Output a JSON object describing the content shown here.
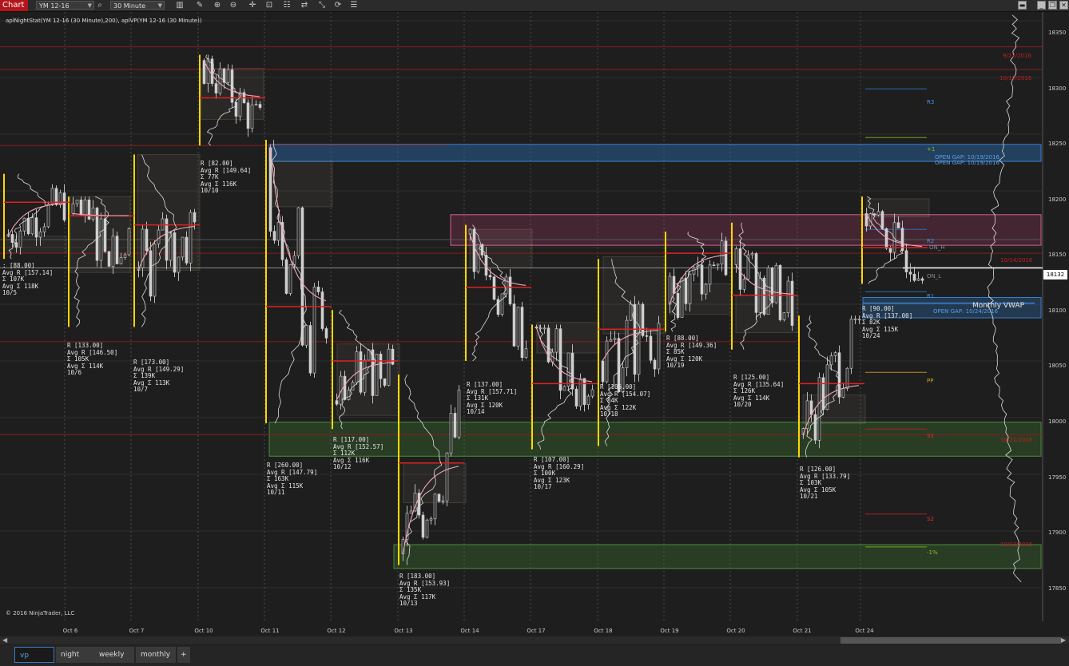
{
  "toolbar": {
    "title": "Chart",
    "instrument": "YM 12-16",
    "interval": "30 Minute",
    "icons": [
      "search-icon",
      "bar-style-icon",
      "zoom-in-icon",
      "zoom-out-icon",
      "crosshair-icon",
      "data-box-icon",
      "properties-icon",
      "drawing-tools-icon",
      "refresh-icon",
      "indicator-list-icon",
      "pencil-icon"
    ]
  },
  "study_label": "aplNightStat(YM 12-16 (30 Minute),200), aplVP(YM 12-16 (30 Minute))",
  "copyright": "© 2016 NinjaTrader, LLC",
  "last_price": "18132",
  "price_axis": [
    "18350",
    "18300",
    "18250",
    "18200",
    "18150",
    "18100",
    "18050",
    "18000",
    "17950",
    "17900",
    "17850"
  ],
  "dates": [
    "Oct 6",
    "Oct 7",
    "Oct 10",
    "Oct 11",
    "Oct 12",
    "Oct 13",
    "Oct 14",
    "Oct 17",
    "Oct 18",
    "Oct 19",
    "Oct 20",
    "Oct 21",
    "Oct 24"
  ],
  "stats": [
    {
      "lines": [
        ": [88.00]",
        "Avg R [157.14]",
        "Σ 107K",
        "Avg Σ 118K",
        "10/5"
      ]
    },
    {
      "lines": [
        "R [133.00]",
        "Avg R [146.50]",
        "Σ 105K",
        "Avg Σ 114K",
        "10/6"
      ]
    },
    {
      "lines": [
        "R [173.00]",
        "Avg R [149.29]",
        "Σ 139K",
        "Avg Σ 113K",
        "10/7"
      ]
    },
    {
      "lines": [
        "R [82.00]",
        "Avg R [149.64]",
        "Σ 77K",
        "Avg Σ 116K",
        "10/10"
      ]
    },
    {
      "lines": [
        "R [260.00]",
        "Avg R [147.79]",
        "Σ 163K",
        "Avg Σ 115K",
        "10/11"
      ]
    },
    {
      "lines": [
        "R [117.00]",
        "Avg R [152.57]",
        "Σ 112K",
        "Avg Σ 116K",
        "10/12"
      ]
    },
    {
      "lines": [
        "R [183.00]",
        "Avg R [153.93]",
        "Σ 135K",
        "Avg Σ 117K",
        "10/13"
      ]
    },
    {
      "lines": [
        "R [137.00]",
        "Avg R [157.71]",
        "Σ 131K",
        "Avg Σ 120K",
        "10/14"
      ]
    },
    {
      "lines": [
        "R [107.00]",
        "Avg R [160.29]",
        "Σ 100K",
        "Avg Σ 123K",
        "10/17"
      ]
    },
    {
      "lines": [
        "R [105.00]",
        "Avg R [154.07]",
        "Σ 84K",
        "Avg Σ 122K",
        "10/18"
      ]
    },
    {
      "lines": [
        "R [88.00]",
        "Avg R [149.36]",
        "Σ 85K",
        "Avg Σ 120K",
        "10/19"
      ]
    },
    {
      "lines": [
        "R [125.00]",
        "Avg R [135.64]",
        "Σ 126K",
        "Avg Σ 114K",
        "10/20"
      ]
    },
    {
      "lines": [
        "R [126.00]",
        "Avg R [133.79]",
        "Σ 103K",
        "Avg Σ 105K",
        "10/21"
      ]
    },
    {
      "lines": [
        "R [90.00]",
        "Avg R [137.00]",
        "Σ 82K",
        "Avg Σ 115K",
        "10/24"
      ]
    }
  ],
  "levels": {
    "r3": "R3",
    "plus1": "+1",
    "r2": "R2",
    "on_h": "ON_H",
    "on_l": "ON_L",
    "r1": "R1",
    "pp": "PP",
    "s1": "S1",
    "s2": "S2",
    "minus1": "-1%",
    "d_9_27": "9/27/2016",
    "d_10_10": "10/10/2016",
    "d_10_14": "10/14/2016",
    "d_10_21": "10/21/2016",
    "d_10_13": "10/13/2016",
    "gap1": "OPEN GAP: 10/19/2016",
    "gap2": "OPEN GAP: 10/19/2016",
    "gap3": "OPEN GAP: 10/24/2016",
    "monthly_vwap": "Monthly VWAP"
  },
  "tabs": [
    "vp",
    "night",
    "weekly",
    "monthly"
  ],
  "add_tab": "+",
  "colors": {
    "accent_red": "#b3151b",
    "gap_blue": "#2a6db0",
    "pink_zone": "#d4608f",
    "green_zone": "#4c8c3c",
    "poc": "#e02020",
    "open_line": "#ffd700"
  }
}
